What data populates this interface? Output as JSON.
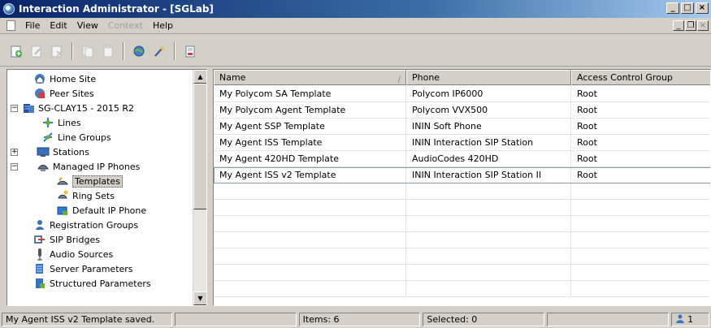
{
  "window": {
    "title": "Interaction Administrator - [SGLab]"
  },
  "menu": {
    "items": [
      "File",
      "Edit",
      "View",
      "Context",
      "Help"
    ],
    "disabled": [
      "Context"
    ]
  },
  "toolbar": {
    "icons": [
      "new-icon",
      "edit-icon",
      "delete-icon",
      "copy-icon",
      "paste-icon",
      "globe-icon",
      "wand-icon",
      "properties-icon"
    ]
  },
  "tree": {
    "items": [
      {
        "label": "Home Site",
        "icon": "home-site-icon"
      },
      {
        "label": "Peer Sites",
        "icon": "peer-sites-icon"
      },
      {
        "label": "SG-CLAY15 - 2015 R2",
        "icon": "server-icon"
      },
      {
        "label": "Lines",
        "icon": "lines-icon"
      },
      {
        "label": "Line Groups",
        "icon": "line-groups-icon"
      },
      {
        "label": "Stations",
        "icon": "stations-icon"
      },
      {
        "label": "Managed IP Phones",
        "icon": "ip-phone-icon"
      },
      {
        "label": "Templates",
        "icon": "templates-icon"
      },
      {
        "label": "Ring Sets",
        "icon": "ring-sets-icon"
      },
      {
        "label": "Default IP Phone",
        "icon": "default-phone-icon"
      },
      {
        "label": "Registration Groups",
        "icon": "registration-icon"
      },
      {
        "label": "SIP Bridges",
        "icon": "sip-bridge-icon"
      },
      {
        "label": "Audio Sources",
        "icon": "audio-icon"
      },
      {
        "label": "Server Parameters",
        "icon": "server-params-icon"
      },
      {
        "label": "Structured Parameters",
        "icon": "structured-params-icon"
      }
    ],
    "selected": "Templates"
  },
  "list": {
    "columns": [
      "Name",
      "Phone",
      "Access Control Group"
    ],
    "rows": [
      [
        "My Polycom SA Template",
        "Polycom IP6000",
        "Root"
      ],
      [
        "My Polycom Agent Template",
        "Polycom VVX500",
        "Root"
      ],
      [
        "My Agent SSP Template",
        "ININ Soft Phone",
        "Root"
      ],
      [
        "My Agent ISS Template",
        "ININ Interaction SIP Station",
        "Root"
      ],
      [
        "My Agent 420HD Template",
        "AudioCodes 420HD",
        "Root"
      ],
      [
        "My Agent ISS v2 Template",
        "ININ Interaction SIP Station II",
        "Root"
      ]
    ]
  },
  "status": {
    "message": "My Agent ISS v2 Template saved.",
    "items": "Items: 6",
    "selected": "Selected: 0",
    "user_suffix": "1"
  }
}
